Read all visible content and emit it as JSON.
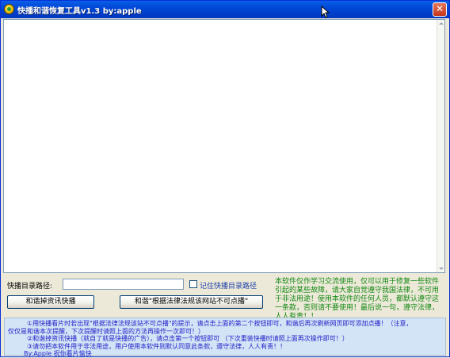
{
  "window": {
    "title": "快播和谐恢复工具v1.3 by:apple",
    "close_glyph": "✕"
  },
  "form": {
    "path_label": "快播目录路径:",
    "path_value": "",
    "remember_label": "记住快播目录路径",
    "remember_checked": false
  },
  "buttons": {
    "clean_ads": "和谐掉资讯快播",
    "clean_notice": "和谐\"根据法律法规该网站不可点播\""
  },
  "notice": "本软件仅作学习交流使用，仅可以用于修复一些软件引起的某些故障，请大家自觉遵守我国法律，不可用于非法用途！使用本软件的任何人员，都默认遵守这一条款，否则请不要使用！最后说一句，遵守法律，人人有责！！",
  "info": {
    "line1": "①用快播看片时若出现\"根据法律法规该站不可点播\"的提示，请点击上面的第二个按钮即可，和谐后再次刷新网页即可添加点播！（注意，",
    "line2": "仅仅是和谐本次提醒，下次提醒时请照上面的方法再操作一次即可！）",
    "line3": "②和谐掉资讯快播（就自了就是快播的广告），请点击第一个按钮即可    （下次重装快播时请照上面再次操作即可！）",
    "line4": "③请勿把本软件用于非法用途，用户使用本软件则默认同意此条款，遵守法律，人人有责！！",
    "signature": "By:Apple    祝你看片愉快"
  },
  "colors": {
    "title_bar": "#0047D6",
    "notice_text": "#138813",
    "info_text": "#2020C8",
    "info_bg": "#D3E4F6"
  }
}
